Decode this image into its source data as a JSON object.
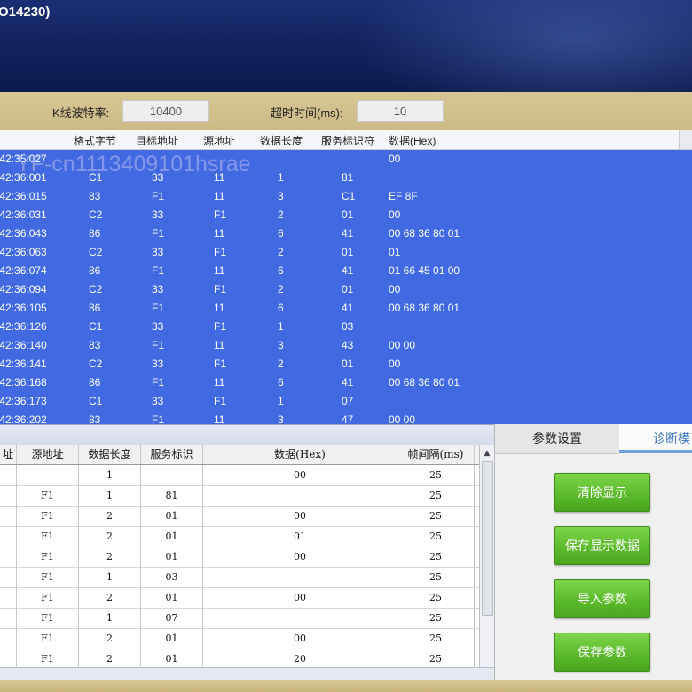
{
  "window": {
    "title": "O14230)"
  },
  "settings": {
    "baud_label": "K线波特率:",
    "baud_value": "10400",
    "timeout_label": "超时时间(ms):",
    "timeout_value": "10"
  },
  "log": {
    "headers": [
      "格式字节",
      "目标地址",
      "源地址",
      "数据长度",
      "服务标识符",
      "数据(Hex)"
    ],
    "watermark": "YF-cn1113409101hsrae",
    "rows": [
      {
        "time": ":42:35:027",
        "fmt": "",
        "dst": "",
        "src": "",
        "len": "",
        "sid": "",
        "data": "00"
      },
      {
        "time": ":42:36:001",
        "fmt": "C1",
        "dst": "33",
        "src": "11",
        "len": "1",
        "sid": "81",
        "data": ""
      },
      {
        "time": ":42:36:015",
        "fmt": "83",
        "dst": "F1",
        "src": "11",
        "len": "3",
        "sid": "C1",
        "data": "EF 8F"
      },
      {
        "time": ":42:36:031",
        "fmt": "C2",
        "dst": "33",
        "src": "F1",
        "len": "2",
        "sid": "01",
        "data": "00"
      },
      {
        "time": ":42:36:043",
        "fmt": "86",
        "dst": "F1",
        "src": "11",
        "len": "6",
        "sid": "41",
        "data": "00 68 36 80 01"
      },
      {
        "time": ":42:36:063",
        "fmt": "C2",
        "dst": "33",
        "src": "F1",
        "len": "2",
        "sid": "01",
        "data": "01"
      },
      {
        "time": ":42:36:074",
        "fmt": "86",
        "dst": "F1",
        "src": "11",
        "len": "6",
        "sid": "41",
        "data": "01 66 45 01 00"
      },
      {
        "time": ":42:36:094",
        "fmt": "C2",
        "dst": "33",
        "src": "F1",
        "len": "2",
        "sid": "01",
        "data": "00"
      },
      {
        "time": ":42:36:105",
        "fmt": "86",
        "dst": "F1",
        "src": "11",
        "len": "6",
        "sid": "41",
        "data": "00 68 36 80 01"
      },
      {
        "time": ":42:36:126",
        "fmt": "C1",
        "dst": "33",
        "src": "F1",
        "len": "1",
        "sid": "03",
        "data": ""
      },
      {
        "time": ":42:36:140",
        "fmt": "83",
        "dst": "F1",
        "src": "11",
        "len": "3",
        "sid": "43",
        "data": "00 00"
      },
      {
        "time": ":42:36:141",
        "fmt": "C2",
        "dst": "33",
        "src": "F1",
        "len": "2",
        "sid": "01",
        "data": "00"
      },
      {
        "time": ":42:36:168",
        "fmt": "86",
        "dst": "F1",
        "src": "11",
        "len": "6",
        "sid": "41",
        "data": "00 68 36 80 01"
      },
      {
        "time": ":42:36:173",
        "fmt": "C1",
        "dst": "33",
        "src": "F1",
        "len": "1",
        "sid": "07",
        "data": ""
      },
      {
        "time": ":42:36:202",
        "fmt": "83",
        "dst": "F1",
        "src": "11",
        "len": "3",
        "sid": "47",
        "data": "00 00"
      }
    ]
  },
  "table": {
    "headers": [
      "址",
      "源地址",
      "数据长度",
      "服务标识",
      "数据(Hex)",
      "帧间隔(ms)"
    ],
    "rows": [
      {
        "c0": "",
        "src": "",
        "len": "1",
        "sid": "",
        "data": "00",
        "gap": "25"
      },
      {
        "c0": "",
        "src": "F1",
        "len": "1",
        "sid": "81",
        "data": "",
        "gap": "25"
      },
      {
        "c0": "",
        "src": "F1",
        "len": "2",
        "sid": "01",
        "data": "00",
        "gap": "25"
      },
      {
        "c0": "",
        "src": "F1",
        "len": "2",
        "sid": "01",
        "data": "01",
        "gap": "25"
      },
      {
        "c0": "",
        "src": "F1",
        "len": "2",
        "sid": "01",
        "data": "00",
        "gap": "25"
      },
      {
        "c0": "",
        "src": "F1",
        "len": "1",
        "sid": "03",
        "data": "",
        "gap": "25"
      },
      {
        "c0": "",
        "src": "F1",
        "len": "2",
        "sid": "01",
        "data": "00",
        "gap": "25"
      },
      {
        "c0": "",
        "src": "F1",
        "len": "1",
        "sid": "07",
        "data": "",
        "gap": "25"
      },
      {
        "c0": "",
        "src": "F1",
        "len": "2",
        "sid": "01",
        "data": "00",
        "gap": "25"
      },
      {
        "c0": "",
        "src": "F1",
        "len": "2",
        "sid": "01",
        "data": "20",
        "gap": "25"
      }
    ]
  },
  "panel": {
    "tabs": [
      "参数设置",
      "诊断模"
    ],
    "buttons": {
      "clear": "清除显示",
      "save_display": "保存显示数据",
      "import_params": "导入参数",
      "save_params": "保存参数"
    }
  },
  "colors": {
    "log_bg": "#4169e1",
    "banner_bg": "#12235f",
    "settings_bg": "#d6c692",
    "button_green": "#5cbb2c",
    "active_tab_text": "#3a76c6"
  }
}
